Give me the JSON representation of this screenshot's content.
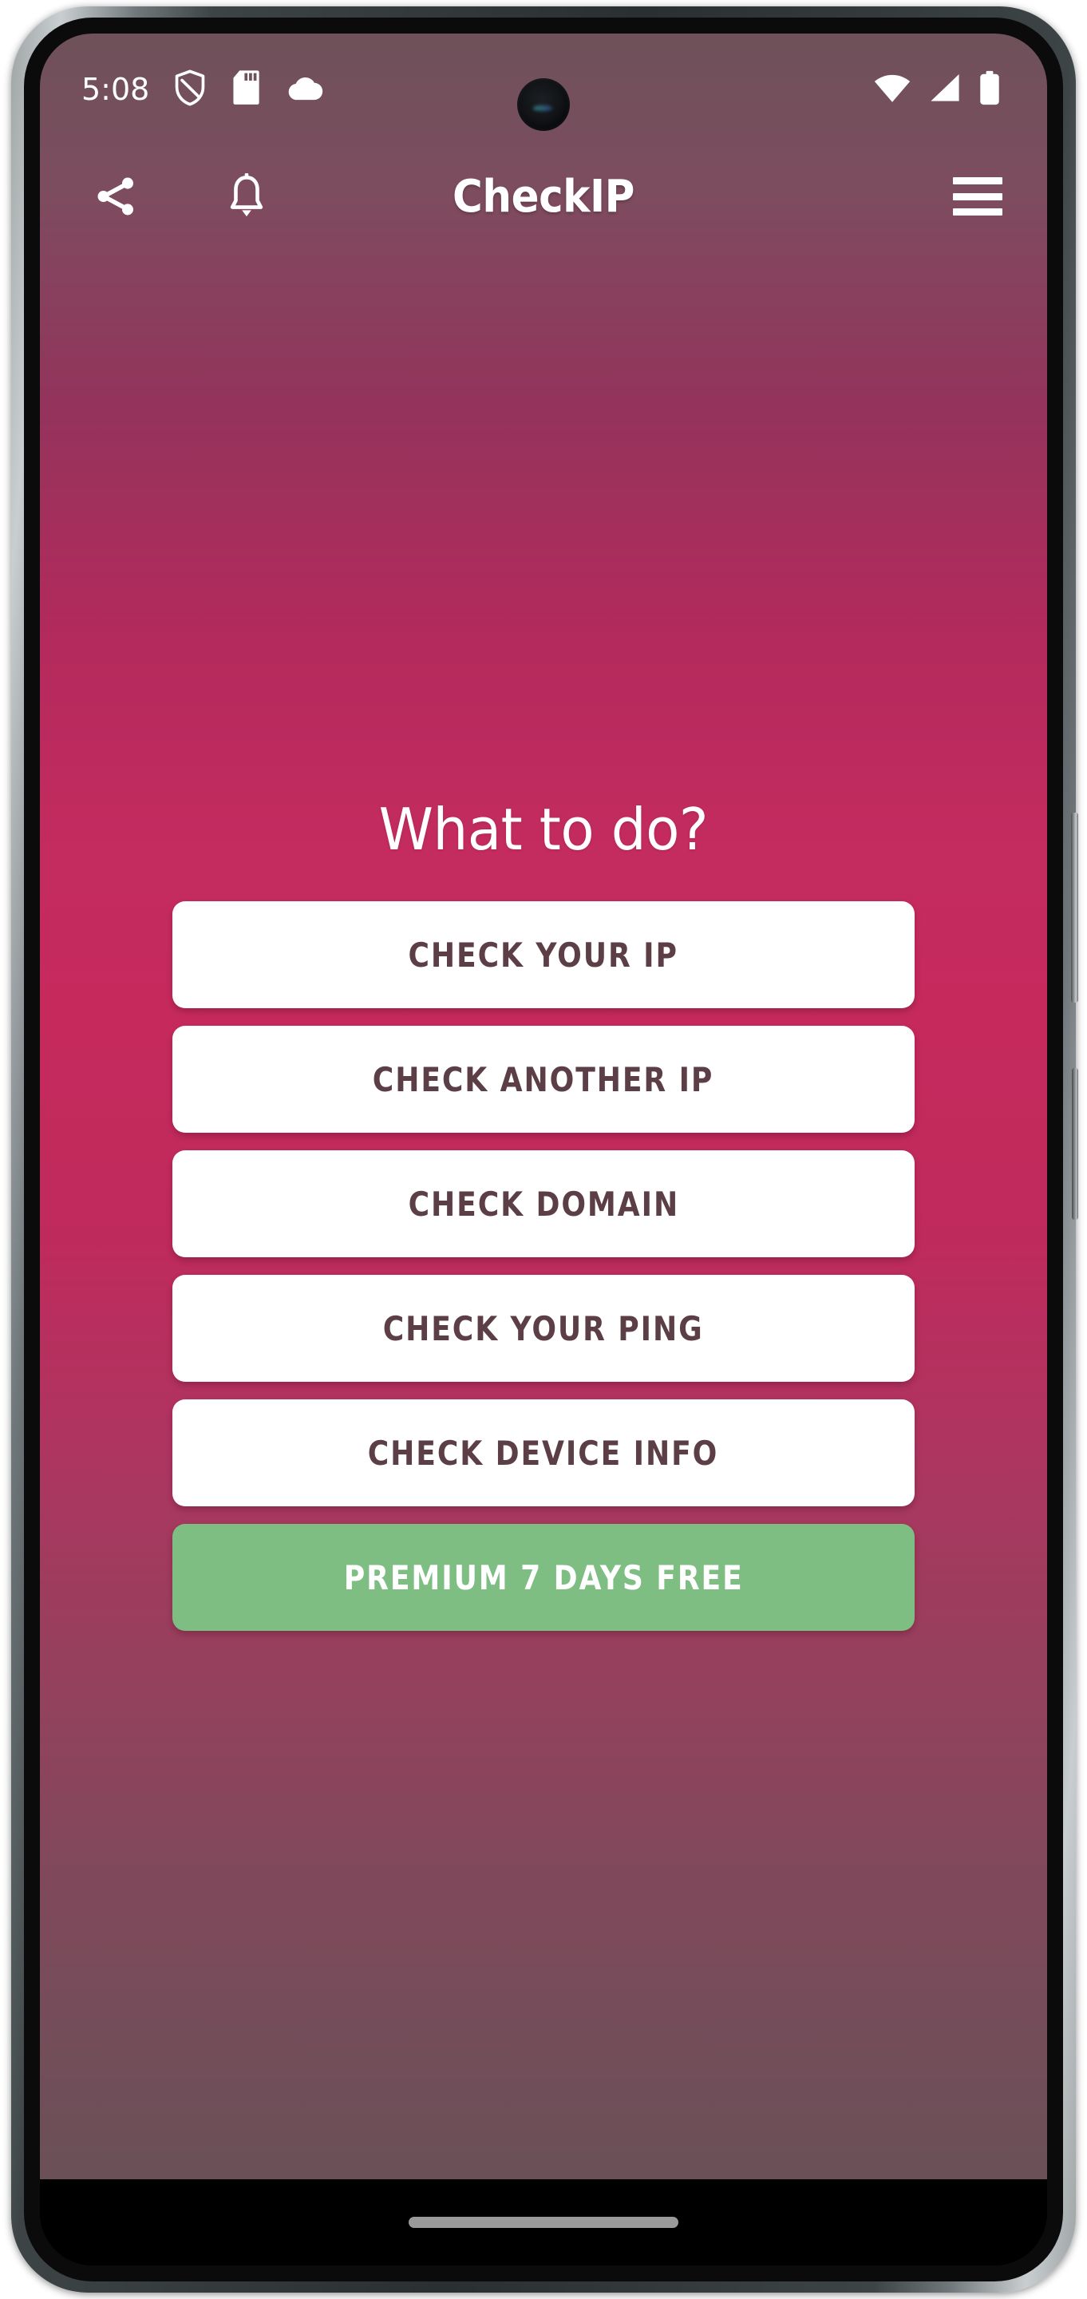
{
  "status_bar": {
    "clock": "5:08",
    "left_icons": [
      {
        "name": "vpn-shield-icon"
      },
      {
        "name": "sd-card-icon"
      },
      {
        "name": "cloud-icon"
      }
    ],
    "right_icons": [
      {
        "name": "wifi-icon"
      },
      {
        "name": "cellular-signal-icon"
      },
      {
        "name": "battery-icon"
      }
    ]
  },
  "app_bar": {
    "title": "CheckIP",
    "share_icon": "share-icon",
    "notification_icon": "bell-icon",
    "menu_icon": "hamburger-menu-icon"
  },
  "main": {
    "heading": "What to do?",
    "actions": [
      {
        "label": "CHECK YOUR IP",
        "style": "light"
      },
      {
        "label": "CHECK ANOTHER IP",
        "style": "light"
      },
      {
        "label": "CHECK DOMAIN",
        "style": "light"
      },
      {
        "label": "CHECK YOUR PING",
        "style": "light"
      },
      {
        "label": "CHECK DEVICE INFO",
        "style": "light"
      },
      {
        "label": "PREMIUM 7 DAYS FREE",
        "style": "premium"
      }
    ]
  },
  "nav_bar": {
    "gesture_pill": "gesture-home-pill"
  },
  "colors": {
    "gradient_top": "#6e515a",
    "gradient_mid": "#c42b5f",
    "gradient_bottom": "#6b5058",
    "button_light_bg": "#ffffff",
    "button_light_text": "#5c3f46",
    "button_premium_bg": "#7fbe83",
    "button_premium_text": "#ffffff",
    "status_text": "#ffffff"
  }
}
